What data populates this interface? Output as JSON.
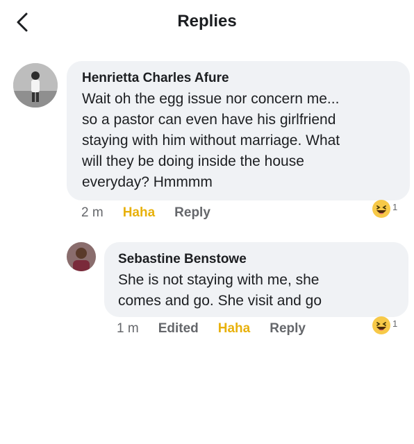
{
  "header": {
    "title": "Replies",
    "back_icon": "chevron-left-icon"
  },
  "comments": [
    {
      "author": "Henrietta Charles Afure",
      "text": "Wait oh the egg issue nor concern me...\nso a pastor can even have his girlfriend\nstaying with him without marriage. What\nwill they be doing inside the house\neveryday? Hmmmm",
      "time": "2 m",
      "edited": "",
      "haha_label": "Haha",
      "reply_label": "Reply",
      "reaction": {
        "icon": "laughing-emoji-icon",
        "count": "1"
      }
    },
    {
      "author": "Sebastine Benstowe",
      "text": "She is not staying with me, she\ncomes and go. She visit and go",
      "time": "1 m",
      "edited": "Edited",
      "haha_label": "Haha",
      "reply_label": "Reply",
      "reaction": {
        "icon": "laughing-emoji-icon",
        "count": "1"
      }
    }
  ],
  "colors": {
    "bubble": "#f0f2f5",
    "haha": "#e8b10c",
    "meta": "#65676b",
    "text": "#1c1e21"
  }
}
